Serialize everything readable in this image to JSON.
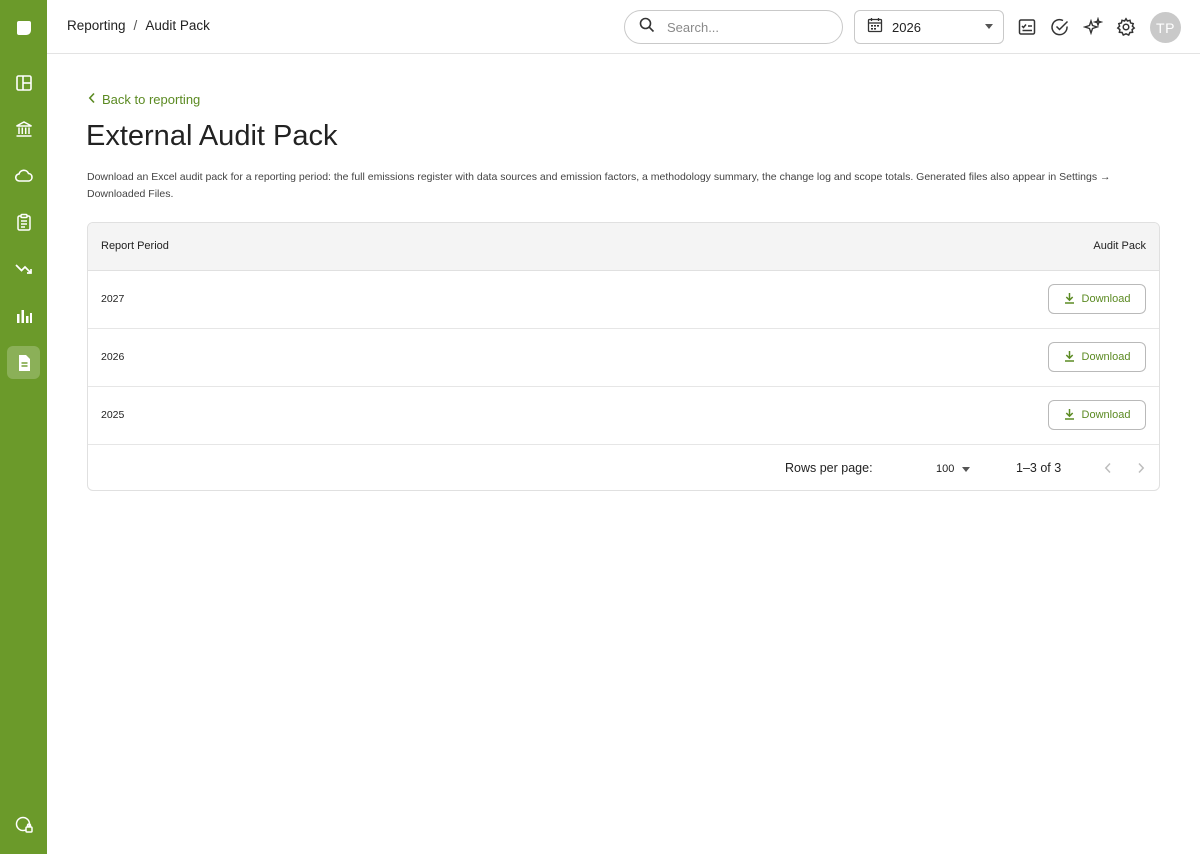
{
  "app": {
    "brand_color": "#6b9a2a",
    "accent_color": "#5b8a22"
  },
  "sidebar": {
    "items": [
      {
        "icon": "logo-icon"
      },
      {
        "icon": "dashboard-icon"
      },
      {
        "icon": "bank-icon"
      },
      {
        "icon": "cloud-icon"
      },
      {
        "icon": "clipboard-icon"
      },
      {
        "icon": "trend-down-icon"
      },
      {
        "icon": "bar-chart-icon"
      },
      {
        "icon": "document-icon",
        "active": true
      },
      {
        "icon": "globe-lock-icon"
      }
    ]
  },
  "header": {
    "breadcrumb": {
      "parent": "Reporting",
      "separator": "/",
      "current": "Audit Pack"
    },
    "search": {
      "placeholder": "Search..."
    },
    "year_select": {
      "value": "2026"
    },
    "icons": [
      "checklist-icon",
      "check-circle-icon",
      "sparkles-icon",
      "settings-icon"
    ],
    "avatar": {
      "initials": "TP"
    }
  },
  "main": {
    "back_link": "Back to reporting",
    "title": "External Audit Pack",
    "description": "Download an Excel audit pack for a reporting period: the full emissions register with data sources and emission factors, a methodology summary, the change log and scope totals. Generated files also appear in Settings → Downloaded Files.",
    "table": {
      "columns": [
        "Report Period",
        "Audit Pack"
      ],
      "rows": [
        {
          "period": "2027",
          "action": "Download"
        },
        {
          "period": "2026",
          "action": "Download"
        },
        {
          "period": "2025",
          "action": "Download"
        }
      ],
      "footer": {
        "rows_per_page_label": "Rows per page:",
        "rows_per_page_value": "100",
        "range": "1–3 of 3"
      }
    }
  }
}
